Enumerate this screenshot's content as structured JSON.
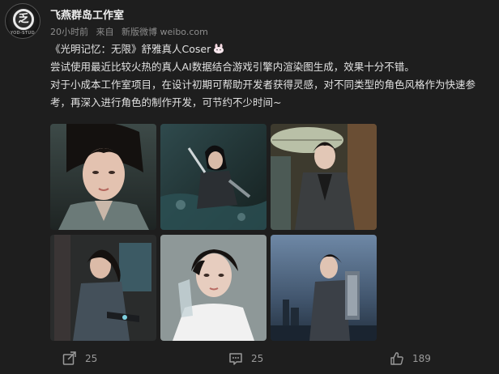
{
  "post": {
    "author": "飞燕群岛工作室",
    "avatar_text": "YOD-STUD",
    "avatar_mark": "乏",
    "meta": {
      "time": "20小时前",
      "source_prefix": "来自",
      "source": "新版微博 weibo.com"
    },
    "paragraphs": {
      "line1": "《光明记忆：无限》舒雅真人Coser",
      "line2": "尝试使用最近比较火热的真人AI数据结合游戏引擎内渲染图生成，效果十分不错。",
      "line3": "对于小成本工作室项目，在设计初期可帮助开发者获得灵感，对不同类型的角色风格作为快速参考，再深入进行角色的制作开发，可节约不少时间~"
    },
    "emoji": "rabbit-face-emoji"
  },
  "actions": {
    "repost_count": "25",
    "comment_count": "25",
    "like_count": "189"
  },
  "images": [
    {
      "name": "photo-1",
      "subject": "closeup-portrait"
    },
    {
      "name": "photo-2",
      "subject": "crouching-with-blade-in-water"
    },
    {
      "name": "photo-3",
      "subject": "umbrella-street-scene"
    },
    {
      "name": "photo-4",
      "subject": "interior-with-gun"
    },
    {
      "name": "photo-5",
      "subject": "white-shirt-portrait"
    },
    {
      "name": "photo-6",
      "subject": "mecha-backpack-city"
    }
  ]
}
